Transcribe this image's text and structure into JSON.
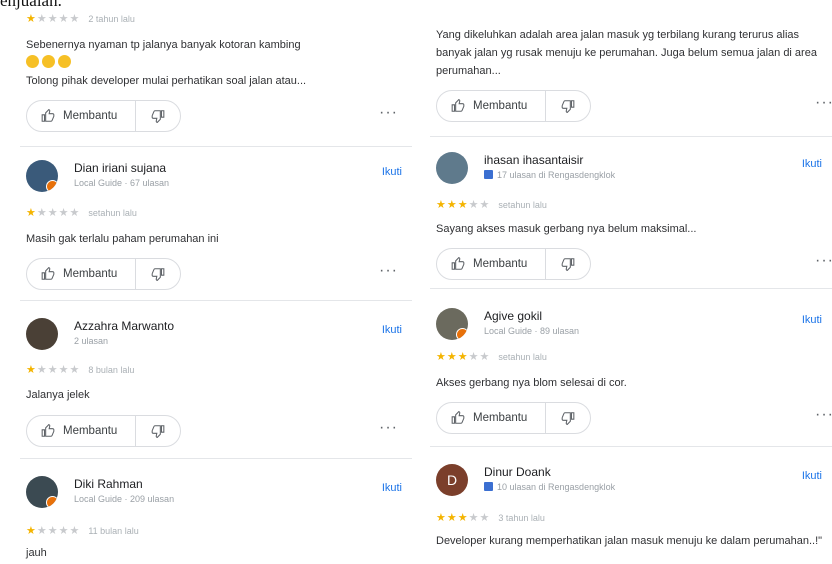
{
  "top_text": "enjualan.",
  "ui": {
    "helpful": "Membantu",
    "follow": "Ikuti",
    "more": "···"
  },
  "left_reviews": [
    {
      "rating": 1,
      "ago": "2 tahun lalu",
      "text": "Sebenernya nyaman tp jalanya banyak kotoran kambing",
      "text2": "Tolong pihak developer mulai perhatikan soal jalan atau...",
      "emoji_count": 3
    },
    {
      "name": "Dian iriani sujana",
      "sub": "Local Guide · 67 ulasan",
      "rating": 1,
      "ago": "setahun lalu",
      "text": "Masih gak terlalu paham perumahan ini",
      "avatar_color": "#3a5a7a"
    },
    {
      "name": "Azzahra Marwanto",
      "sub": "2 ulasan",
      "rating": 1,
      "ago": "8 bulan lalu",
      "text": "Jalanya jelek",
      "avatar_color": "#4a4036"
    },
    {
      "name": "Diki Rahman",
      "sub": "Local Guide · 209 ulasan",
      "rating": 1,
      "ago": "11 bulan lalu",
      "text": "jauh",
      "avatar_color": "#3b4a52"
    }
  ],
  "right_reviews": [
    {
      "text": "Yang dikeluhkan adalah area jalan masuk yg terbilang kurang terurus alias banyak jalan yg rusak menuju ke perumahan. Juga belum semua jalan di area perumahan..."
    },
    {
      "name": "ihasan ihasantaisir",
      "sub": "17 ulasan di Rengasdengklok",
      "rating": 3,
      "ago": "setahun lalu",
      "text": "Sayang akses masuk gerbang nya belum maksimal...",
      "avatar_color": "#5f7a8c"
    },
    {
      "name": "Agive gokil",
      "sub": "Local Guide · 89 ulasan",
      "rating": 3,
      "ago": "setahun lalu",
      "text": "Akses gerbang nya blom selesai di cor.",
      "avatar_color": "#6b6a5e"
    },
    {
      "name": "Dinur Doank",
      "avatar_letter": "D",
      "sub": "10 ulasan di Rengasdengklok",
      "rating": 3,
      "ago": "3 tahun lalu",
      "text": "Developer kurang memperhatikan jalan masuk menuju ke dalam perumahan..!\"",
      "avatar_color": "#7b3f2b"
    }
  ]
}
